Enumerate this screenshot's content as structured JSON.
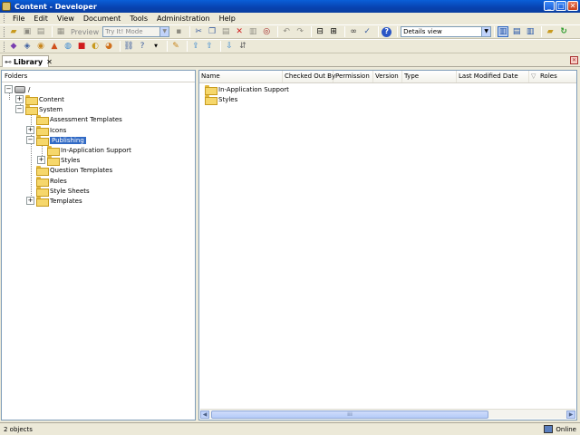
{
  "window": {
    "title": "Content - Developer"
  },
  "menu": [
    "File",
    "Edit",
    "View",
    "Document",
    "Tools",
    "Administration",
    "Help"
  ],
  "toolbar1": {
    "preview_label": "Preview",
    "mode_value": "Try It! Mode",
    "view_value": "Details view"
  },
  "tab": {
    "label": "Library",
    "close": "✕"
  },
  "folders": {
    "header": "Folders",
    "root": "/",
    "items": [
      {
        "label": "Content",
        "expander": "+"
      },
      {
        "label": "System",
        "expander": "−"
      },
      {
        "label": "Assessment Templates",
        "expander": ""
      },
      {
        "label": "Icons",
        "expander": "+"
      },
      {
        "label": "Publishing",
        "expander": "−"
      },
      {
        "label": "In-Application Support",
        "expander": ""
      },
      {
        "label": "Styles",
        "expander": "+"
      },
      {
        "label": "Question Templates",
        "expander": ""
      },
      {
        "label": "Roles",
        "expander": ""
      },
      {
        "label": "Style Sheets",
        "expander": ""
      },
      {
        "label": "Templates",
        "expander": "+"
      }
    ]
  },
  "content": {
    "columns": [
      "Name",
      "Checked Out By",
      "Permission",
      "Version",
      "Type",
      "Last Modified Date",
      "Roles"
    ],
    "rows": [
      "In-Application Support",
      "Styles"
    ],
    "scroll_grip": "⁞⁞⁞"
  },
  "status": {
    "left": "2 objects",
    "right": "Online"
  }
}
